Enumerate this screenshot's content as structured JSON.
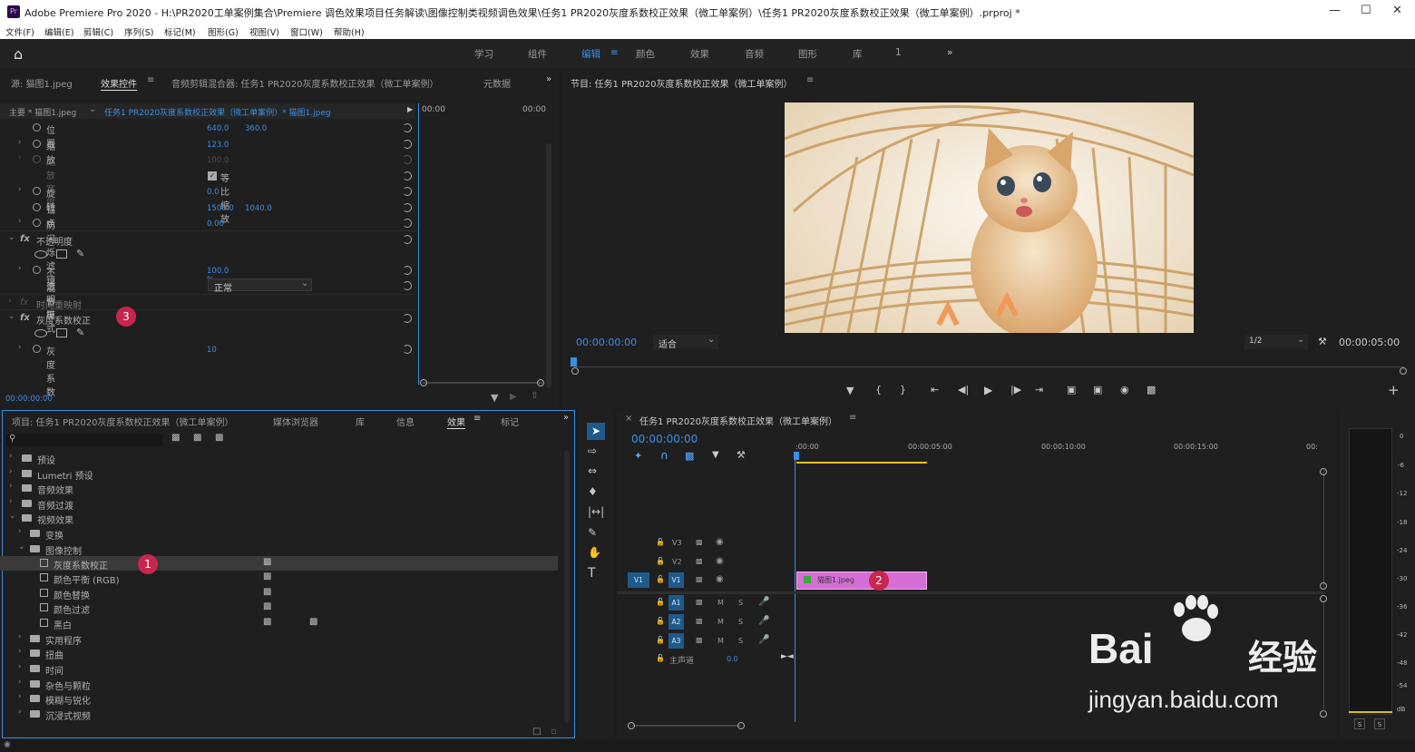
{
  "window": {
    "title": "Adobe Premiere Pro 2020 - H:\\PR2020工单案例集合\\Premiere 调色效果项目任务解读\\图像控制类视频调色效果\\任务1 PR2020灰度系数校正效果（微工单案例）\\任务1 PR2020灰度系数校正效果（微工单案例）.prproj *",
    "logo": "Pr"
  },
  "menu": [
    "文件(F)",
    "编辑(E)",
    "剪辑(C)",
    "序列(S)",
    "标记(M)",
    "图形(G)",
    "视图(V)",
    "窗口(W)",
    "帮助(H)"
  ],
  "workspaces": [
    "学习",
    "组件",
    "编辑",
    "颜色",
    "效果",
    "音频",
    "图形",
    "库",
    "1"
  ],
  "ws_active": "编辑",
  "ec": {
    "tabs": [
      "源: 猫图1.jpeg",
      "效果控件",
      "音频剪辑混合器: 任务1 PR2020灰度系数校正效果（微工单案例）",
      "元数据"
    ],
    "master": "主要 * 猫图1.jpeg",
    "clip": "任务1 PR2020灰度系数校正效果（微工单案例）* 猫图1.jpeg",
    "t0": "00:00",
    "t1": "00:00",
    "props": [
      {
        "label": "位置",
        "v1": "640.0",
        "v2": "360.0"
      },
      {
        "label": "缩放",
        "v1": "123.0"
      },
      {
        "label": "缩放宽度",
        "v1": "100.0"
      },
      {
        "label": "等比缩放"
      },
      {
        "label": "旋转",
        "v1": "0.0"
      },
      {
        "label": "锚点",
        "v1": "1500.0",
        "v2": "1040.0"
      },
      {
        "label": "防闪烁滤镜",
        "v1": "0.00"
      },
      {
        "label": "不透明度"
      },
      {
        "label": "不透明度",
        "v1": "100.0 %"
      },
      {
        "label": "混合模式",
        "v1": "正常"
      },
      {
        "label": "时间重映射"
      },
      {
        "label": "灰度系数校正"
      },
      {
        "label": "灰度系数",
        "v1": "10"
      }
    ],
    "time": "00:00:00:00"
  },
  "program": {
    "title": "节目: 任务1 PR2020灰度系数校正效果（微工单案例）",
    "tc": "00:00:00:00",
    "fit": "适合",
    "res": "1/2",
    "dur": "00:00:05:00"
  },
  "project": {
    "tabs": [
      "项目: 任务1 PR2020灰度系数校正效果（微工单案例）",
      "媒体浏览器",
      "库",
      "信息",
      "效果",
      "标记"
    ],
    "tree": [
      "预设",
      "Lumetri 预设",
      "音频效果",
      "音频过渡",
      "视频效果",
      "变换",
      "图像控制",
      "灰度系数校正",
      "颜色平衡 (RGB)",
      "颜色替换",
      "颜色过滤",
      "黑白",
      "实用程序",
      "扭曲",
      "时间",
      "杂色与颗粒",
      "模糊与锐化",
      "沉浸式视频"
    ]
  },
  "timeline": {
    "title": "任务1 PR2020灰度系数校正效果（微工单案例）",
    "tc": "00:00:00:00",
    "ruler": [
      ":00:00",
      "00:00:05:00",
      "00:00:10:00",
      "00:00:15:00",
      "00:"
    ],
    "vtracks": [
      "V3",
      "V2",
      "V1"
    ],
    "atracks": [
      "A1",
      "A2",
      "A3"
    ],
    "src_v": "V1",
    "master": "主声道",
    "master_val": "0.0",
    "clip": "猫图1.jpeg",
    "m": "M",
    "s": "S"
  },
  "meter": {
    "ticks": [
      "0",
      "-6",
      "-12",
      "-18",
      "-24",
      "-30",
      "-36",
      "-42",
      "-48",
      "-54",
      "dB"
    ],
    "s": "S"
  },
  "badges": [
    "1",
    "2",
    "3"
  ],
  "watermark": {
    "logo": "Bai",
    "cn": "经验",
    "url": "jingyan.baidu.com"
  }
}
